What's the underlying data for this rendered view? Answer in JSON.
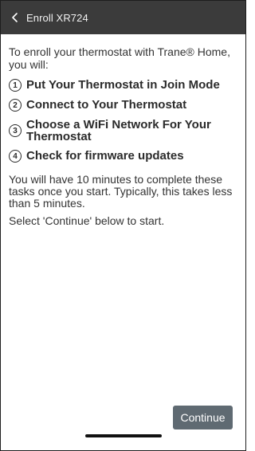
{
  "header": {
    "back_icon": "chevron-left-icon",
    "title": "Enroll XR724",
    "background_color": "#3b3b3b"
  },
  "main": {
    "intro": "To enroll your thermostat with Trane® Home, you will:",
    "steps": [
      {
        "number": "1",
        "label": "Put Your Thermostat in Join Mode"
      },
      {
        "number": "2",
        "label": "Connect to Your Thermostat"
      },
      {
        "number": "3",
        "label": "Choose a WiFi Network For Your Thermostat"
      },
      {
        "number": "4",
        "label": "Check for firmware updates"
      }
    ],
    "time_note": "You will have 10 minutes to complete these tasks once you start. Typically, this takes less than 5 minutes.",
    "instruction": "Select 'Continue' below to start."
  },
  "footer": {
    "continue_label": "Continue",
    "continue_color": "#5f6a72"
  }
}
